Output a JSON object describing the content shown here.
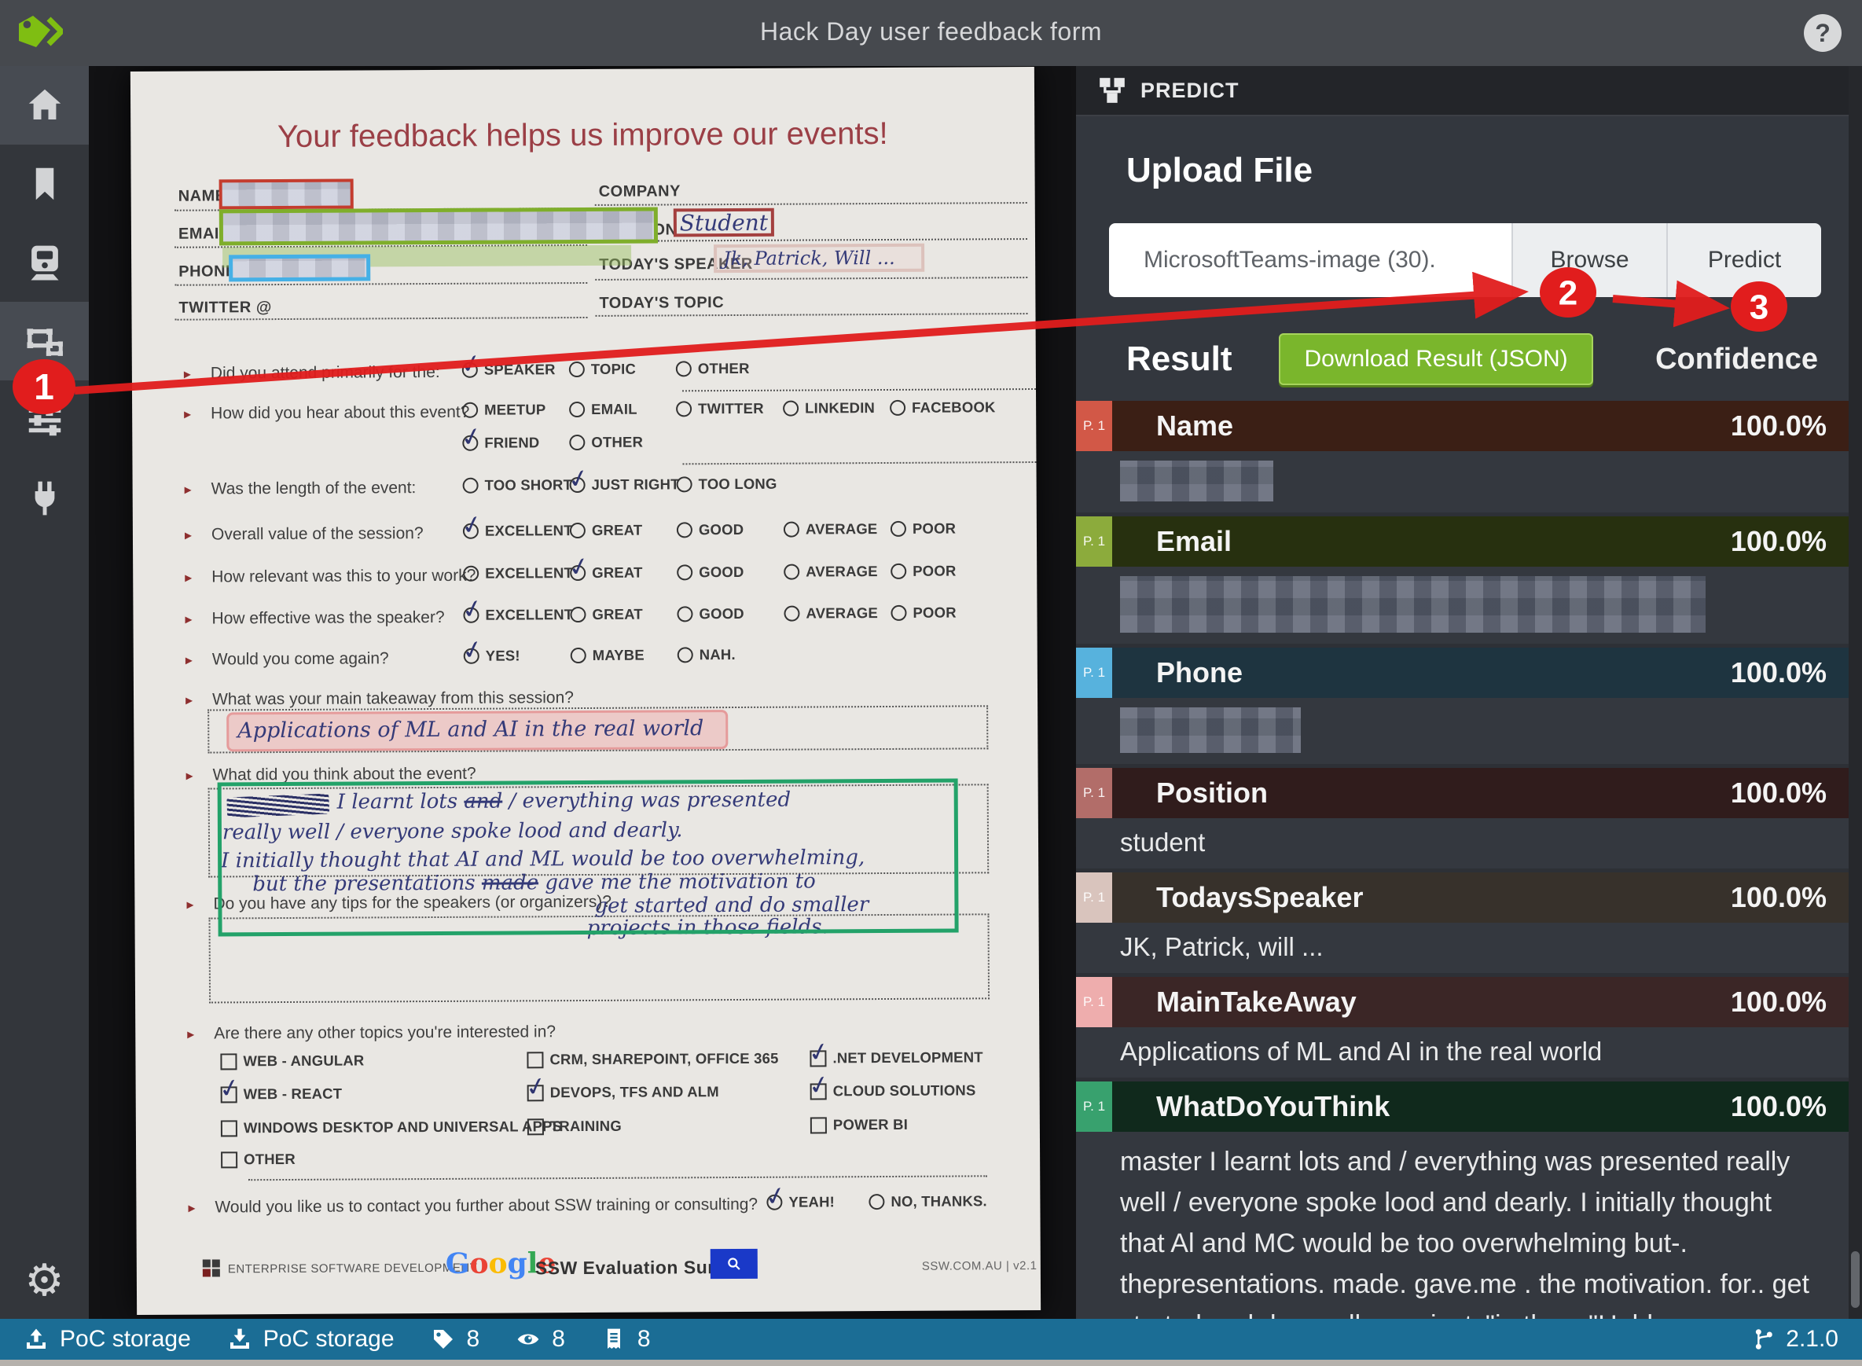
{
  "topbar": {
    "title": "Hack Day user feedback form",
    "logo_icon": "tags-icon",
    "help_icon": "help-icon"
  },
  "sidebar": {
    "items": [
      {
        "icon": "home-icon",
        "active": true
      },
      {
        "icon": "bookmark-icon",
        "active": false
      },
      {
        "icon": "train-icon",
        "active": false
      },
      {
        "icon": "tag-editor-icon",
        "active": true
      },
      {
        "icon": "sliders-icon",
        "active": false
      },
      {
        "icon": "plug-icon",
        "active": false
      },
      {
        "icon": "gear-icon",
        "active": false
      }
    ]
  },
  "annotations": {
    "step1": "1",
    "step2": "2",
    "step3": "3",
    "color": "#e11d1d"
  },
  "predict": {
    "header": "PREDICT",
    "upload_heading": "Upload File",
    "file_name": "MicrosoftTeams-image (30).",
    "browse_label": "Browse",
    "predict_label": "Predict",
    "result_heading": "Result",
    "download_label": "Download Result (JSON)",
    "confidence_heading": "Confidence",
    "accent_green": "#7ab62c",
    "rows": [
      {
        "page": "P. 1",
        "label": "Name",
        "confidence": "100.0%",
        "value": "",
        "value_redacted": true,
        "badge_color": "#d25847",
        "row_color": "#3b1f15"
      },
      {
        "page": "P. 1",
        "label": "Email",
        "confidence": "100.0%",
        "value": "",
        "value_redacted": true,
        "badge_color": "#8cab3c",
        "row_color": "#27300f"
      },
      {
        "page": "P. 1",
        "label": "Phone",
        "confidence": "100.0%",
        "value": "",
        "value_redacted": true,
        "badge_color": "#57b2dd",
        "row_color": "#1e3440"
      },
      {
        "page": "P. 1",
        "label": "Position",
        "confidence": "100.0%",
        "value": "student",
        "value_redacted": false,
        "badge_color": "#b26d69",
        "row_color": "#301c1c"
      },
      {
        "page": "P. 1",
        "label": "TodaysSpeaker",
        "confidence": "100.0%",
        "value": "JK, Patrick, will ...",
        "value_redacted": false,
        "badge_color": "#d9c4bd",
        "row_color": "#37312b"
      },
      {
        "page": "P. 1",
        "label": "MainTakeAway",
        "confidence": "100.0%",
        "value": "Applications of ML and AI in the real world",
        "value_redacted": false,
        "badge_color": "#eeadad",
        "row_color": "#3b2626"
      },
      {
        "page": "P. 1",
        "label": "WhatDoYouThink",
        "confidence": "100.0%",
        "value": "master I learnt lots and / everything was presented really well / everyone spoke lood and dearly. I initially thought that Al and MC would be too overwhelming but-. thepresentations. made. gave.me . the motivation. for.. get started and do smaller projects\"in those\"Helds.",
        "value_redacted": false,
        "badge_color": "#38a16e",
        "row_color": "#10291c"
      }
    ]
  },
  "statusbar": {
    "source_label": "PoC storage",
    "target_label": "PoC storage",
    "tags_count": "8",
    "visited_count": "8",
    "assets_count": "8",
    "version": "2.1.0",
    "bar_color": "#1b6d95"
  },
  "form": {
    "title": "Your feedback helps us improve our events!",
    "fields": {
      "name_label": "NAME",
      "email_label": "EMAIL",
      "phone_label": "PHONE",
      "twitter_label": "TWITTER @",
      "company_label": "COMPANY",
      "position_label": "POSITION",
      "position_value": "Student",
      "speaker_label": "TODAY'S SPEAKER",
      "speaker_value": "Jk, Patrick, Will ...",
      "topic_label": "TODAY'S TOPIC"
    },
    "q_attend": {
      "label": "Did you attend primarily for the:",
      "options": [
        "SPEAKER",
        "TOPIC",
        "OTHER"
      ],
      "selected": "SPEAKER"
    },
    "q_hear": {
      "label": "How did you hear about this event?",
      "options_row1": [
        "MEETUP",
        "EMAIL",
        "TWITTER",
        "LINKEDIN",
        "FACEBOOK"
      ],
      "options_row2": [
        "FRIEND",
        "OTHER"
      ],
      "selected": "FRIEND"
    },
    "q_length": {
      "label": "Was the length of the event:",
      "options": [
        "TOO SHORT",
        "JUST RIGHT",
        "TOO LONG"
      ],
      "selected": "JUST RIGHT"
    },
    "rating_options": [
      "EXCELLENT",
      "GREAT",
      "GOOD",
      "AVERAGE",
      "POOR"
    ],
    "q_value": {
      "label": "Overall value of the session?",
      "selected": "EXCELLENT"
    },
    "q_relevant": {
      "label": "How relevant was this to your work?",
      "selected": "GREAT"
    },
    "q_effective": {
      "label": "How effective was the speaker?",
      "selected": "EXCELLENT"
    },
    "q_again": {
      "label": "Would you come again?",
      "options": [
        "YES!",
        "MAYBE",
        "NAH."
      ],
      "selected": "YES!"
    },
    "q_takeaway": {
      "label": "What was your main takeaway from this session?",
      "answer": "Applications of ML and AI in the real world"
    },
    "q_think": {
      "label": "What did you think about the event?",
      "line1_a": "I learnt lots",
      "line1_struck": "and",
      "line1_b": "/ everything was presented",
      "line2": "really well / everyone spoke lood and dearly.",
      "line3": "I initially thought that AI and ML would be too overwhelming,",
      "line4_a": "but the presentations",
      "line4_struck": "made",
      "line4_b": "gave me the motivation to",
      "line5": "get started and do smaller",
      "line6": "projects in those fields."
    },
    "q_tips": {
      "label": "Do you have any tips for the speakers (or organizers)?"
    },
    "q_topics": {
      "label": "Are there any other topics you're interested in?",
      "col1": [
        "WEB - ANGULAR",
        "WEB - REACT",
        "WINDOWS DESKTOP AND UNIVERSAL APPS",
        "OTHER"
      ],
      "col2": [
        "CRM, SHAREPOINT, OFFICE 365",
        "DEVOPS, TFS AND ALM",
        "TRAINING"
      ],
      "col3": [
        ".NET DEVELOPMENT",
        "CLOUD SOLUTIONS",
        "POWER BI"
      ],
      "checked": [
        "WEB - REACT",
        "DEVOPS, TFS AND ALM",
        ".NET DEVELOPMENT",
        "CLOUD SOLUTIONS"
      ]
    },
    "q_contact": {
      "label": "Would you like us to contact you further about SSW training or consulting?",
      "options": [
        "YEAH!",
        "NO, THANKS."
      ],
      "selected": "YEAH!"
    },
    "footer": {
      "enterprise": "ENTERPRISE SOFTWARE DEVELOPMENT",
      "google": "Google",
      "survey": "SSW Evaluation Survey",
      "site": "SSW.COM.AU  |  v2.1"
    }
  }
}
